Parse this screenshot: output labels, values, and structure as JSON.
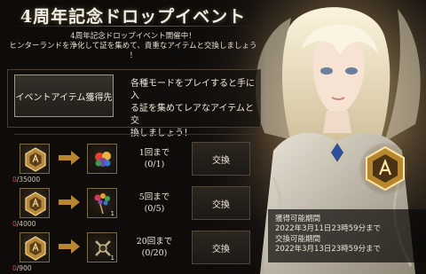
{
  "title": "4周年記念ドロップイベント",
  "subtitle": [
    "4周年記念ドロップイベント開催中！",
    "ヒンターランドを浄化して証を集めて、貴重なアイテムと交換しましょう",
    "！"
  ],
  "event": {
    "button_label": "イベントアイテム獲得先",
    "description_lines": [
      "各種モードをプレイすると手に入",
      "る証を集めてレアなアイテムと交",
      "換しましょう！"
    ]
  },
  "exchange_rows": [
    {
      "current": "0",
      "required": "/35000",
      "reward_icon": "rainbow-gem-icon",
      "reward_qty": "",
      "limit_label": "1回まで",
      "limit_progress": "(0/1)",
      "button_label": "交換"
    },
    {
      "current": "0",
      "required": "/4000",
      "reward_icon": "gem-bouquet-icon",
      "reward_qty": "1",
      "limit_label": "5回まで",
      "limit_progress": "(0/5)",
      "button_label": "交換"
    },
    {
      "current": "0",
      "required": "/900",
      "reward_icon": "crossed-weapon-icon",
      "reward_qty": "1",
      "limit_label": "20回まで",
      "limit_progress": "(0/20)",
      "button_label": "交換"
    }
  ],
  "period": {
    "acquire_label": "獲得可能期間",
    "acquire_until": "2022年3月11日23時59分まで",
    "exchange_label": "交換可能期間",
    "exchange_until": "2022年3月13日23時59分まで"
  },
  "colors": {
    "accent_gold": "#c9a55a",
    "count_red": "#d84b3a",
    "panel_bg": "#0e0b09"
  }
}
